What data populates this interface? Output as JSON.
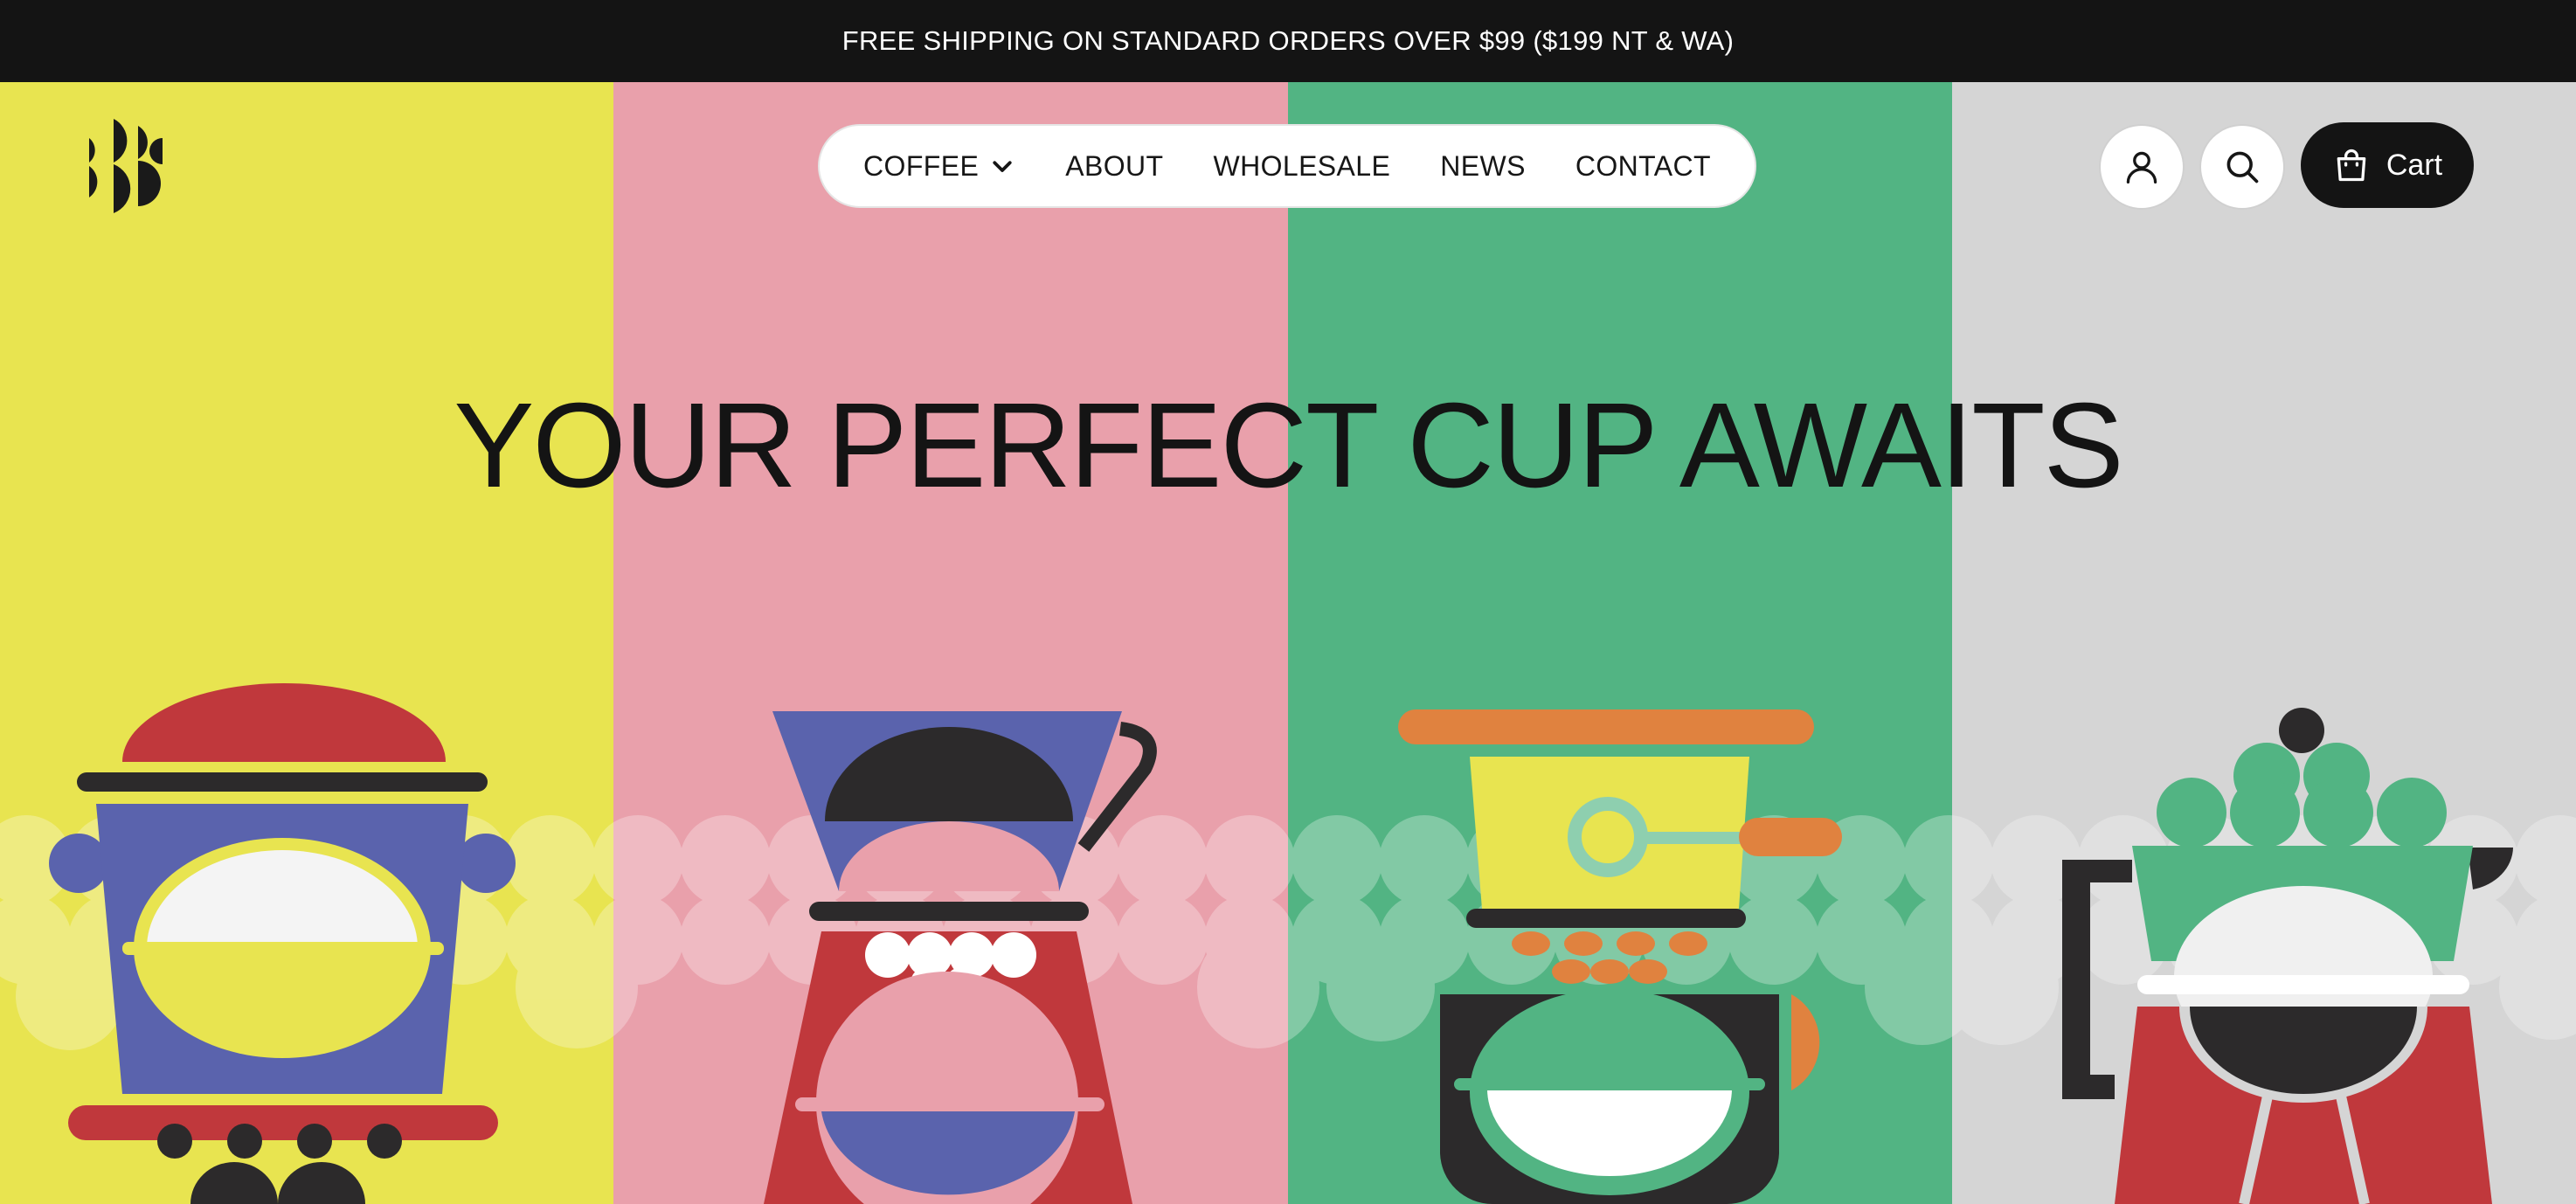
{
  "announcement": {
    "text": "FREE SHIPPING ON STANDARD ORDERS OVER $99 ($199 NT & WA)"
  },
  "nav": {
    "items": [
      {
        "label": "COFFEE",
        "has_dropdown": true
      },
      {
        "label": "ABOUT"
      },
      {
        "label": "WHOLESALE"
      },
      {
        "label": "NEWS"
      },
      {
        "label": "CONTACT"
      }
    ]
  },
  "header_actions": {
    "account_icon": "user-icon",
    "search_icon": "search-icon",
    "cart_icon": "bag-icon",
    "cart_label": "Cart"
  },
  "hero": {
    "headline": "YOUR PERFECT CUP AWAITS",
    "panel_colors": [
      "#e8e450",
      "#e9a0ab",
      "#52b483",
      "#d5d5d5"
    ],
    "illustrations": [
      "coffee-grinder-illustration",
      "pour-over-dripper-illustration",
      "espresso-machine-illustration",
      "moka-pot-illustration"
    ]
  },
  "colors": {
    "dark": "#141414",
    "yellow": "#e8e450",
    "pink": "#e9a0ab",
    "green": "#52b483",
    "grey": "#d5d5d5",
    "blue": "#5a63ad",
    "red": "#c0383c",
    "orange": "#e0823f",
    "charcoal": "#2c2a2b"
  }
}
